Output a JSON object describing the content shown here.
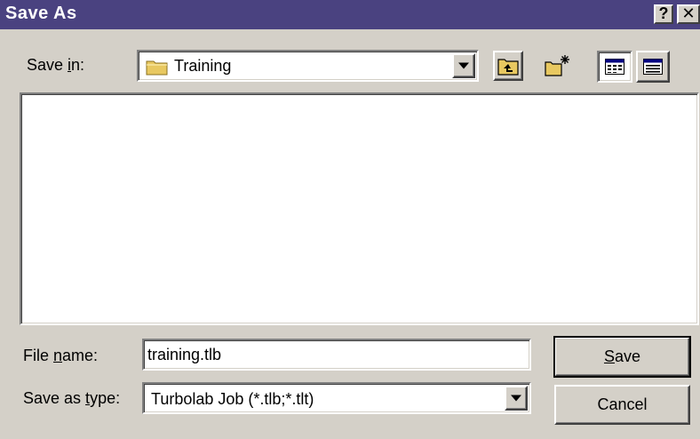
{
  "window": {
    "title": "Save As",
    "help_glyph": "?",
    "close_glyph": "✕"
  },
  "save_in": {
    "label_pre": "Save ",
    "label_mn": "i",
    "label_post": "n:",
    "value": "Training",
    "icon": "folder-icon"
  },
  "toolbar": {
    "icons": [
      "up-one-level-icon",
      "create-new-folder-icon",
      "list-view-icon",
      "details-view-icon"
    ]
  },
  "file_name": {
    "label_pre": "File ",
    "label_mn": "n",
    "label_post": "ame:",
    "value": "training.tlb"
  },
  "save_as_type": {
    "label_pre": "Save as ",
    "label_mn": "t",
    "label_post": "ype:",
    "value": "Turbolab Job (*.tlb;*.tlt)"
  },
  "buttons": {
    "save_mn": "S",
    "save_rest": "ave",
    "cancel": "Cancel"
  },
  "colors": {
    "titlebar": "#4a4280",
    "face": "#d4d0c8"
  }
}
